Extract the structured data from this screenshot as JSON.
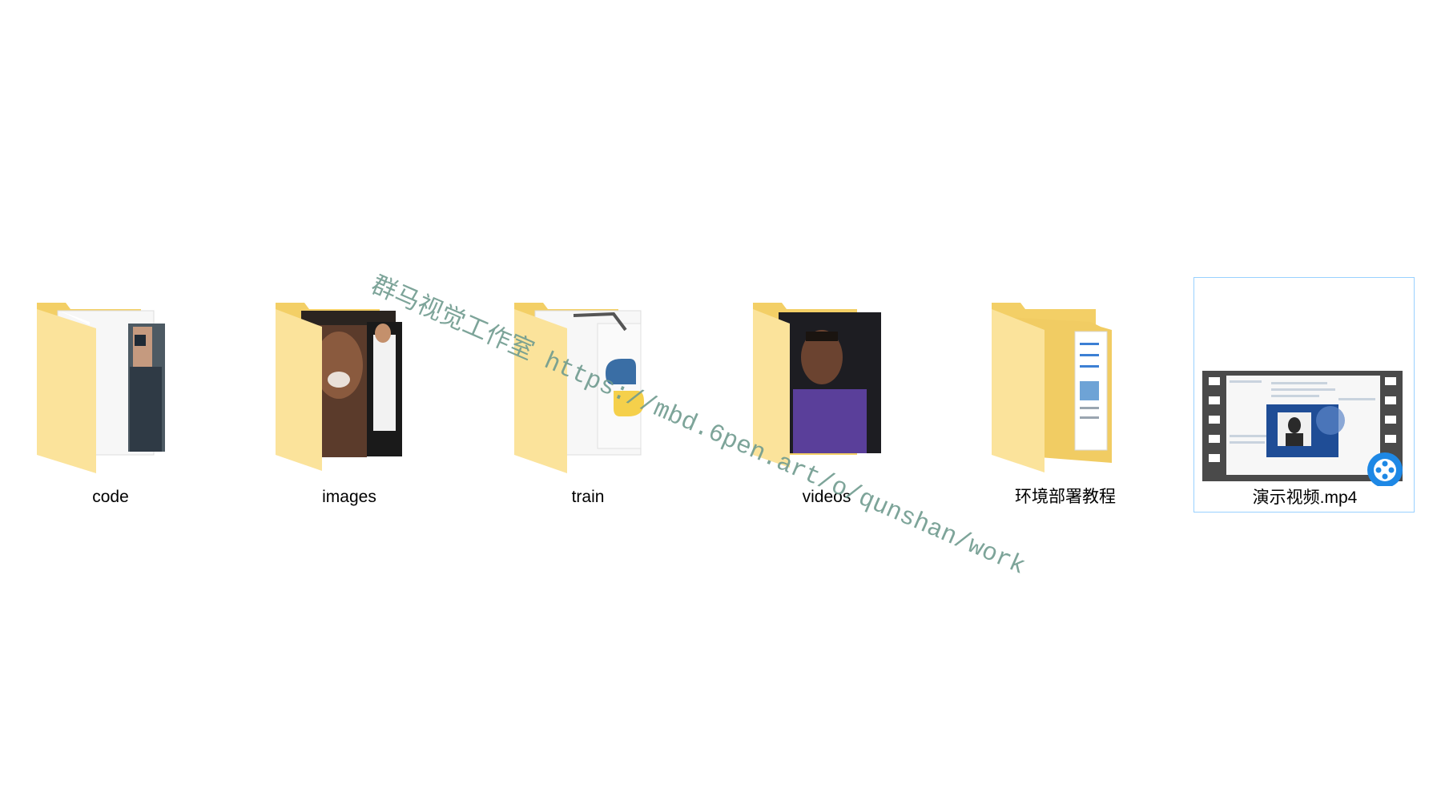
{
  "items": [
    {
      "name": "code",
      "type": "folder",
      "selected": false
    },
    {
      "name": "images",
      "type": "folder",
      "selected": false
    },
    {
      "name": "train",
      "type": "folder",
      "selected": false
    },
    {
      "name": "videos",
      "type": "folder",
      "selected": false
    },
    {
      "name": "环境部署教程",
      "type": "folder",
      "selected": false
    },
    {
      "name": "演示视频.mp4",
      "type": "video-file",
      "selected": true
    }
  ],
  "watermark": "群马视觉工作室 https://mbd.6pen.art/o/qunshan/work",
  "colors": {
    "folder_back": "#f3cf66",
    "folder_front": "#fbe39b",
    "selection_border": "#99d1ff",
    "watermark": "#6f9b8f",
    "player_badge": "#1e88e5"
  },
  "icons": [
    "folder-icon",
    "video-file-icon",
    "player-badge-icon"
  ]
}
